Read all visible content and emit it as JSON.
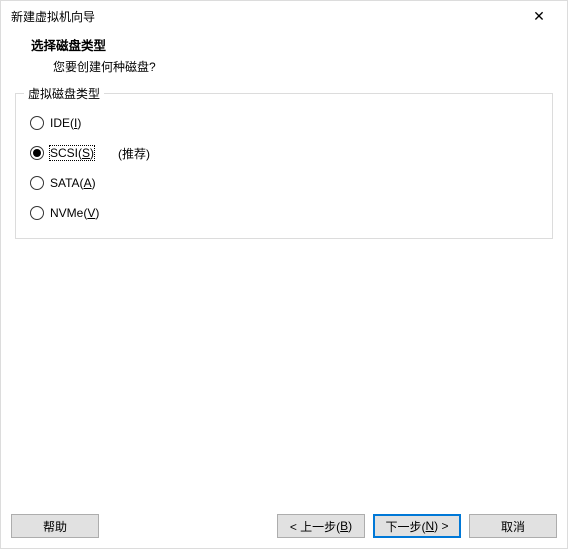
{
  "window": {
    "title": "新建虚拟机向导"
  },
  "header": {
    "title": "选择磁盘类型",
    "subtitle": "您要创建何种磁盘?"
  },
  "group": {
    "legend": "虚拟磁盘类型",
    "options": [
      {
        "prefix": "IDE(",
        "mnemonic": "I",
        "suffix": ")",
        "checked": false,
        "extra": ""
      },
      {
        "prefix": "SCSI(",
        "mnemonic": "S",
        "suffix": ")",
        "checked": true,
        "extra": "(推荐)"
      },
      {
        "prefix": "SATA(",
        "mnemonic": "A",
        "suffix": ")",
        "checked": false,
        "extra": ""
      },
      {
        "prefix": "NVMe(",
        "mnemonic": "V",
        "suffix": ")",
        "checked": false,
        "extra": ""
      }
    ]
  },
  "buttons": {
    "help": "帮助",
    "back_prefix": "< 上一步(",
    "back_mn": "B",
    "back_suffix": ")",
    "next_prefix": "下一步(",
    "next_mn": "N",
    "next_suffix": ") >",
    "cancel": "取消"
  }
}
